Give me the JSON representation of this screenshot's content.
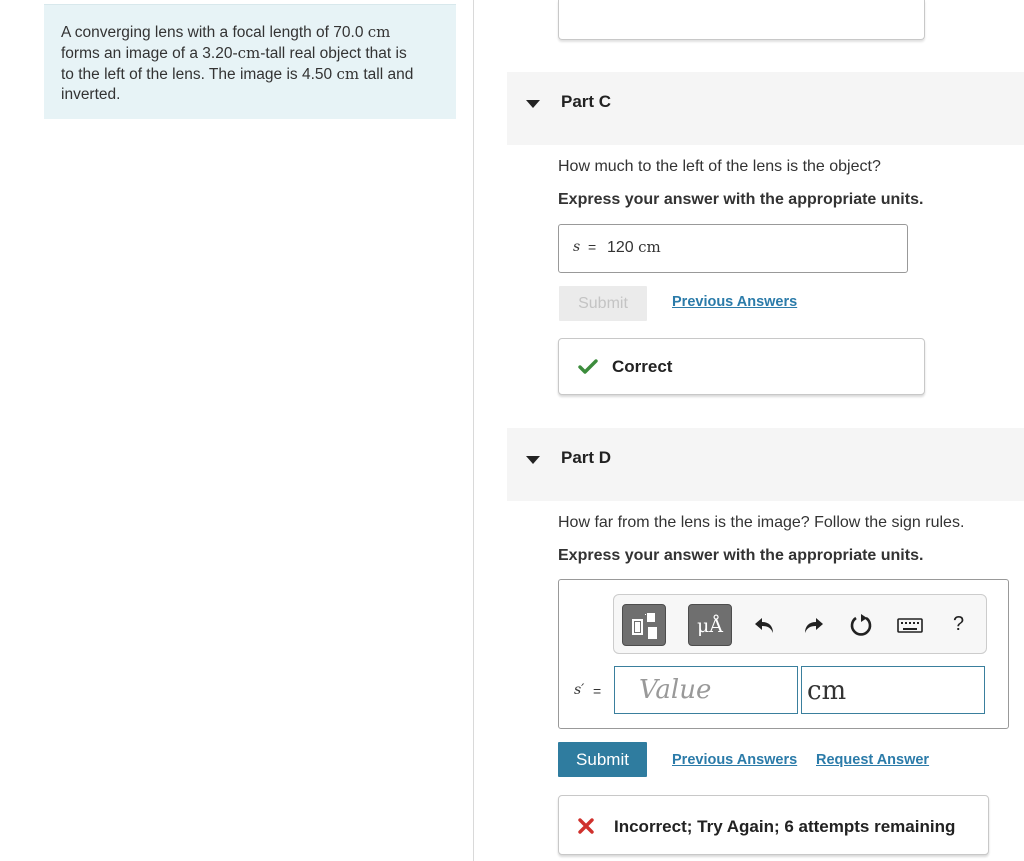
{
  "problem": {
    "parts": [
      "A converging lens with a focal length of 70.0 ",
      "cm",
      "\nforms an image of a 3.20-",
      "cm",
      "-tall real object that is\nto the left of the lens. The image is 4.50 ",
      "cm",
      " tall and\ninverted."
    ]
  },
  "part_c": {
    "title": "Part C",
    "question": "How much to the left of the lens is the object?",
    "instruction": "Express your answer with the appropriate units.",
    "variable": "s",
    "equals": "=",
    "answer_value": "120",
    "answer_unit": "cm",
    "submit_label": "Submit",
    "previous_answers_label": "Previous Answers",
    "feedback": "Correct",
    "feedback_color": "#3c8c3c"
  },
  "part_d": {
    "title": "Part D",
    "question": "How far from the lens is the image? Follow the sign rules.",
    "instruction": "Express your answer with the appropriate units.",
    "variable": "s′",
    "equals": "=",
    "value_placeholder": "Value",
    "unit_value": "cm",
    "toolbar": {
      "units_label": "μÅ",
      "help_label": "?",
      "icons": [
        "templates-icon",
        "units-icon",
        "undo-icon",
        "redo-icon",
        "reset-icon",
        "keyboard-icon",
        "help-icon"
      ]
    },
    "submit_label": "Submit",
    "previous_answers_label": "Previous Answers",
    "request_answer_label": "Request Answer",
    "feedback": "Incorrect; Try Again; 6 attempts remaining",
    "feedback_color": "#d0312d"
  },
  "colors": {
    "accent": "#2f7c9f",
    "link": "#2b7ba9",
    "problem_bg": "#e7f3f6",
    "part_header_bg": "#f5f5f5"
  }
}
